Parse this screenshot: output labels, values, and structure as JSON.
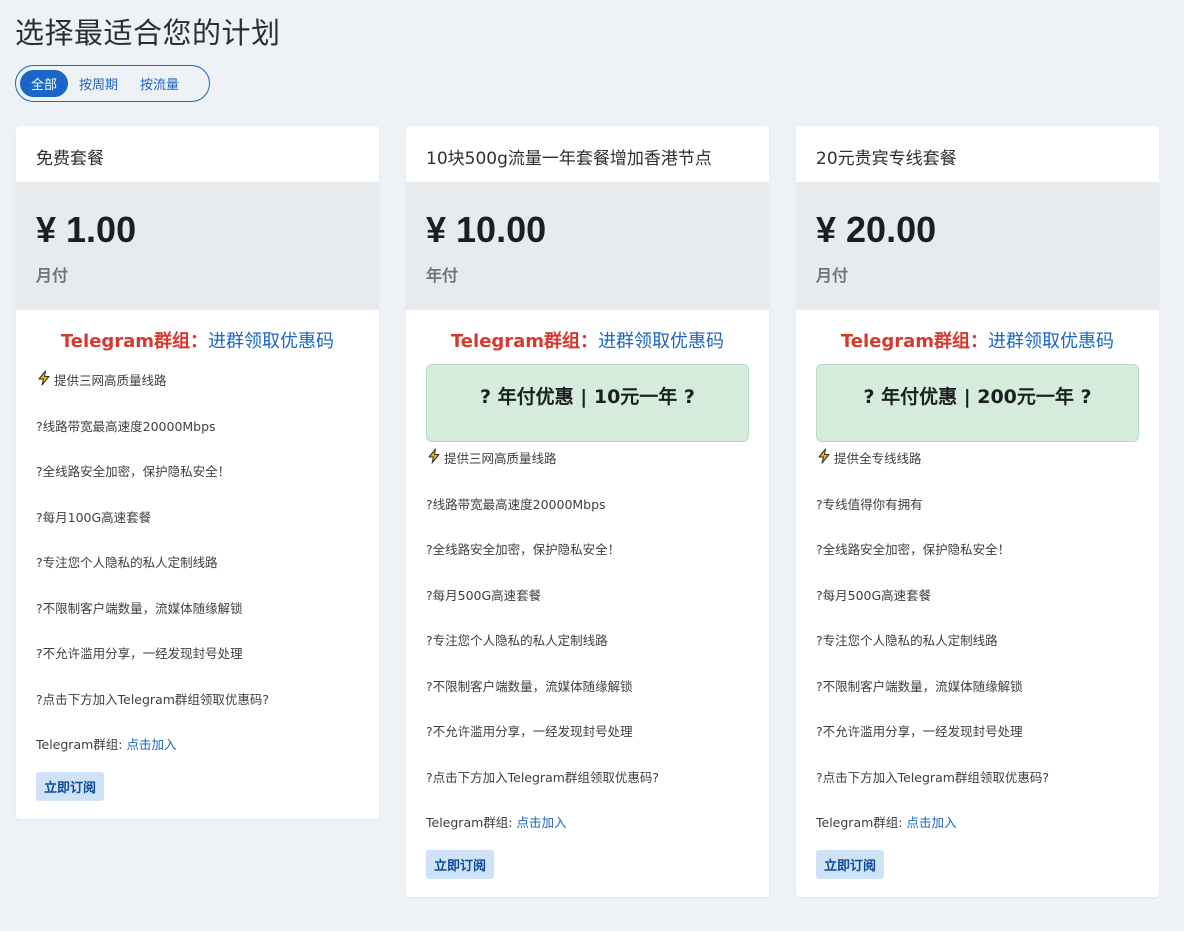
{
  "page": {
    "title": "选择最适合您的计划"
  },
  "filters": [
    {
      "label": "全部",
      "active": true
    },
    {
      "label": "按周期",
      "active": false
    },
    {
      "label": "按流量",
      "active": false
    }
  ],
  "cards": [
    {
      "name": "免费套餐",
      "price": "¥ 1.00",
      "period": "月付",
      "promo_label": "Telegram群组：",
      "promo_link": "进群领取优惠码",
      "highlight": "",
      "features": [
        "提供三网高质量线路",
        "?线路带宽最高速度20000Mbps",
        "?全线路安全加密，保护隐私安全！",
        "?每月100G高速套餐",
        "?专注您个人隐私的私人定制线路",
        "?不限制客户端数量，流媒体随缘解锁",
        "?不允许滥用分享，一经发现封号处理",
        "?点击下方加入Telegram群组领取优惠码?"
      ],
      "tg_label": "Telegram群组: ",
      "tg_link": "点击加入",
      "button": "立即订阅"
    },
    {
      "name": "10块500g流量一年套餐增加香港节点",
      "price": "¥ 10.00",
      "period": "年付",
      "promo_label": "Telegram群组：",
      "promo_link": "进群领取优惠码",
      "highlight": "? 年付优惠 | 10元一年 ?",
      "features": [
        "提供三网高质量线路",
        "?线路带宽最高速度20000Mbps",
        "?全线路安全加密，保护隐私安全！",
        "?每月500G高速套餐",
        "?专注您个人隐私的私人定制线路",
        "?不限制客户端数量，流媒体随缘解锁",
        "?不允许滥用分享，一经发现封号处理",
        "?点击下方加入Telegram群组领取优惠码?"
      ],
      "tg_label": "Telegram群组: ",
      "tg_link": "点击加入",
      "button": "立即订阅"
    },
    {
      "name": "20元贵宾专线套餐",
      "price": "¥ 20.00",
      "period": "月付",
      "promo_label": "Telegram群组：",
      "promo_link": "进群领取优惠码",
      "highlight": "? 年付优惠 | 200元一年 ?",
      "features": [
        "提供全专线线路",
        "?专线值得你有拥有",
        "?全线路安全加密，保护隐私安全！",
        "?每月500G高速套餐",
        "?专注您个人隐私的私人定制线路",
        "?不限制客户端数量，流媒体随缘解锁",
        "?不允许滥用分享，一经发现封号处理",
        "?点击下方加入Telegram群组领取优惠码?"
      ],
      "tg_label": "Telegram群组: ",
      "tg_link": "点击加入",
      "button": "立即订阅"
    }
  ],
  "colors": {
    "accent": "#1a65c7",
    "promo_red": "#d63a2e",
    "highlight_bg": "#d5ecdc",
    "price_bg": "#e8ebee",
    "button_bg": "#cfe2f8"
  },
  "icons": {
    "first_feature": "lightning-bolt-icon"
  }
}
